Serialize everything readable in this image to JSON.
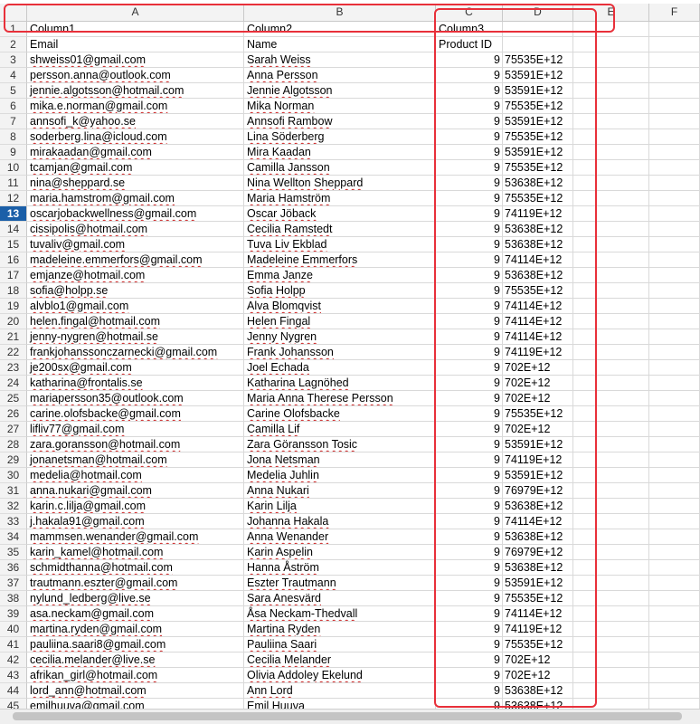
{
  "columns": [
    "A",
    "B",
    "C",
    "D",
    "E",
    "F"
  ],
  "active_row": 13,
  "rows": [
    {
      "n": "1",
      "a": "Column1",
      "b": "Column2",
      "c": "Column3",
      "d": ""
    },
    {
      "n": "2",
      "a": "Email",
      "b": "Name",
      "c": "Product ID",
      "d": ""
    },
    {
      "n": "3",
      "a": "shweiss01@gmail.com",
      "b": "Sarah Weiss",
      "c": "9",
      "d": "75535E+12"
    },
    {
      "n": "4",
      "a": "persson.anna@outlook.com",
      "b": "Anna Persson",
      "c": "9",
      "d": "53591E+12"
    },
    {
      "n": "5",
      "a": "jennie.algotsson@hotmail.com",
      "b": "Jennie Algotsson",
      "c": "9",
      "d": "53591E+12"
    },
    {
      "n": "6",
      "a": "mika.e.norman@gmail.com",
      "b": "Mika Norman",
      "c": "9",
      "d": "75535E+12"
    },
    {
      "n": "7",
      "a": "annsofi_k@yahoo.se",
      "b": "Annsofi Rambow",
      "c": "9",
      "d": "53591E+12"
    },
    {
      "n": "8",
      "a": "soderberg.lina@icloud.com",
      "b": "Lina Söderberg",
      "c": "9",
      "d": "75535E+12"
    },
    {
      "n": "9",
      "a": "mirakaadan@gmail.com",
      "b": "Mira Kaadan",
      "c": "9",
      "d": "53591E+12"
    },
    {
      "n": "10",
      "a": "tcamjan@gmail.com",
      "b": "Camilla Jansson",
      "c": "9",
      "d": "75535E+12"
    },
    {
      "n": "11",
      "a": "nina@sheppard.se",
      "b": "Nina Wellton Sheppard",
      "c": "9",
      "d": "53638E+12"
    },
    {
      "n": "12",
      "a": "maria.hamstrom@gmail.com",
      "b": "Maria Hamström",
      "c": "9",
      "d": "75535E+12"
    },
    {
      "n": "13",
      "a": "oscarjobackwellness@gmail.com",
      "b": "Oscar Jöback",
      "c": "9",
      "d": "74119E+12"
    },
    {
      "n": "14",
      "a": "cissipolis@hotmail.com",
      "b": "Cecilia Ramstedt",
      "c": "9",
      "d": "53638E+12"
    },
    {
      "n": "15",
      "a": "tuvaliv@gmail.com",
      "b": "Tuva Liv Ekblad",
      "c": "9",
      "d": "53638E+12"
    },
    {
      "n": "16",
      "a": "madeleine.emmerfors@gmail.com",
      "b": "Madeleine Emmerfors",
      "c": "9",
      "d": "74114E+12"
    },
    {
      "n": "17",
      "a": "emjanze@hotmail.com",
      "b": "Emma Janze",
      "c": "9",
      "d": "53638E+12"
    },
    {
      "n": "18",
      "a": "sofia@holpp.se",
      "b": "Sofia Holpp",
      "c": "9",
      "d": "75535E+12"
    },
    {
      "n": "19",
      "a": "alvblo1@gmail.com",
      "b": "Alva Blomqvist",
      "c": "9",
      "d": "74114E+12"
    },
    {
      "n": "20",
      "a": "helen.fingal@hotmail.com",
      "b": "Helen Fingal",
      "c": "9",
      "d": "74114E+12"
    },
    {
      "n": "21",
      "a": "jenny-nygren@hotmail.se",
      "b": "Jenny Nygren",
      "c": "9",
      "d": "74114E+12"
    },
    {
      "n": "22",
      "a": "frankjohanssonczarnecki@gmail.com",
      "b": "Frank Johansson",
      "c": "9",
      "d": "74119E+12"
    },
    {
      "n": "23",
      "a": "je200sx@gmail.com",
      "b": "Joel Echada",
      "c": "9",
      "d": "702E+12"
    },
    {
      "n": "24",
      "a": "katharina@frontalis.se",
      "b": "Katharina Lagnöhed",
      "c": "9",
      "d": "702E+12"
    },
    {
      "n": "25",
      "a": "mariapersson35@outlook.com",
      "b": "Maria Anna Therese Persson",
      "c": "9",
      "d": "702E+12"
    },
    {
      "n": "26",
      "a": "carine.olofsbacke@gmail.com",
      "b": "Carine Olofsbacke",
      "c": "9",
      "d": "75535E+12"
    },
    {
      "n": "27",
      "a": "lifliv77@gmail.com",
      "b": "Camilla Lif",
      "c": "9",
      "d": "702E+12"
    },
    {
      "n": "28",
      "a": "zara.goransson@hotmail.com",
      "b": "Zara Göransson Tosic",
      "c": "9",
      "d": "53591E+12"
    },
    {
      "n": "29",
      "a": "jonanetsman@hotmail.com",
      "b": "Jona Netsman",
      "c": "9",
      "d": "74119E+12"
    },
    {
      "n": "30",
      "a": "medelia@hotmail.com",
      "b": "Medelia Juhlin",
      "c": "9",
      "d": "53591E+12"
    },
    {
      "n": "31",
      "a": "anna.nukari@gmail.com",
      "b": "Anna Nukari",
      "c": "9",
      "d": "76979E+12"
    },
    {
      "n": "32",
      "a": "karin.c.lilja@gmail.com",
      "b": "Karin Lilja",
      "c": "9",
      "d": "53638E+12"
    },
    {
      "n": "33",
      "a": "j.hakala91@gmail.com",
      "b": "Johanna Hakala",
      "c": "9",
      "d": "74114E+12"
    },
    {
      "n": "34",
      "a": "mammsen.wenander@gmail.com",
      "b": "Anna Wenander",
      "c": "9",
      "d": "53638E+12"
    },
    {
      "n": "35",
      "a": "karin_kamel@hotmail.com",
      "b": "Karin Aspelin",
      "c": "9",
      "d": "76979E+12"
    },
    {
      "n": "36",
      "a": "schmidthanna@hotmail.com",
      "b": "Hanna Åström",
      "c": "9",
      "d": "53638E+12"
    },
    {
      "n": "37",
      "a": "trautmann.eszter@gmail.com",
      "b": "Eszter Trautmann",
      "c": "9",
      "d": "53591E+12"
    },
    {
      "n": "38",
      "a": "nylund_ledberg@live.se",
      "b": "Sara Anesvärd",
      "c": "9",
      "d": "75535E+12"
    },
    {
      "n": "39",
      "a": "asa.neckam@gmail.com",
      "b": "Åsa Neckam-Thedvall",
      "c": "9",
      "d": "74114E+12"
    },
    {
      "n": "40",
      "a": "martina.ryden@gmail.com",
      "b": "Martina Ryden",
      "c": "9",
      "d": "74119E+12"
    },
    {
      "n": "41",
      "a": "pauliina.saari8@gmail.com",
      "b": "Pauliina Saari",
      "c": "9",
      "d": "75535E+12"
    },
    {
      "n": "42",
      "a": "cecilia.melander@live.se",
      "b": "Cecilia Melander",
      "c": "9",
      "d": "702E+12"
    },
    {
      "n": "43",
      "a": "afrikan_girl@hotmail.com",
      "b": "Olivia Addoley Ekelund",
      "c": "9",
      "d": "702E+12"
    },
    {
      "n": "44",
      "a": "lord_ann@hotmail.com",
      "b": "Ann Lord",
      "c": "9",
      "d": "53638E+12"
    },
    {
      "n": "45",
      "a": "emilhuuva@gmail.com",
      "b": "Emil Huuva",
      "c": "9",
      "d": "53638E+12"
    }
  ]
}
